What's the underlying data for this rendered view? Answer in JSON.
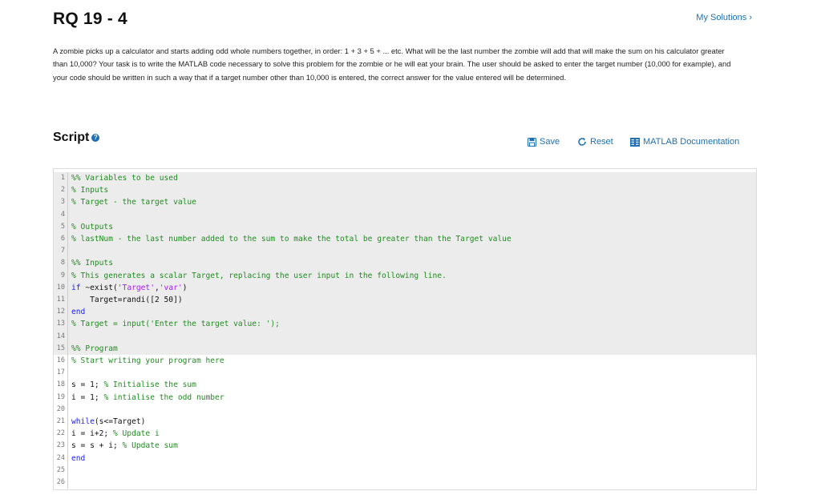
{
  "header": {
    "title": "RQ 19 - 4",
    "my_solutions": "My Solutions ›"
  },
  "problem": {
    "description": "A zombie picks up a calculator and starts adding odd whole numbers together, in order: 1 + 3 + 5 + ... etc. What will be the last number the zombie will add that will make the sum on his calculator greater than 10,000? Your task is to write the MATLAB code necessary to solve this problem for the zombie or he will eat your brain. The user should be asked to enter the target number (10,000 for example), and your code should be written in such a way that if a target number other than 10,000 is entered, the correct answer for the value entered will be determined."
  },
  "script": {
    "label": "Script",
    "help_icon": "?",
    "toolbar": {
      "save": "Save",
      "reset": "Reset",
      "docs": "MATLAB Documentation"
    }
  },
  "code": {
    "lines": [
      {
        "n": "1",
        "segs": [
          {
            "t": "%% Variables to be used",
            "c": "comment"
          }
        ]
      },
      {
        "n": "2",
        "segs": [
          {
            "t": "% Inputs",
            "c": "comment"
          }
        ]
      },
      {
        "n": "3",
        "segs": [
          {
            "t": "% Target - the target value",
            "c": "comment"
          }
        ]
      },
      {
        "n": "4",
        "segs": []
      },
      {
        "n": "5",
        "segs": [
          {
            "t": "% Outputs",
            "c": "comment"
          }
        ]
      },
      {
        "n": "6",
        "segs": [
          {
            "t": "% lastNum - the last number added to the sum to make the total be greater than the Target value",
            "c": "comment"
          }
        ]
      },
      {
        "n": "7",
        "segs": []
      },
      {
        "n": "8",
        "segs": [
          {
            "t": "%% Inputs",
            "c": "comment"
          }
        ]
      },
      {
        "n": "9",
        "segs": [
          {
            "t": "% This generates a scalar Target, replacing the user input in the following line.",
            "c": "comment"
          }
        ]
      },
      {
        "n": "10",
        "segs": [
          {
            "t": "if",
            "c": "kw"
          },
          {
            "t": " ~exist(",
            "c": ""
          },
          {
            "t": "'Target'",
            "c": "str"
          },
          {
            "t": ",",
            "c": ""
          },
          {
            "t": "'var'",
            "c": "str"
          },
          {
            "t": ")",
            "c": ""
          }
        ]
      },
      {
        "n": "11",
        "segs": [
          {
            "t": "    Target=randi([2 50])",
            "c": ""
          }
        ]
      },
      {
        "n": "12",
        "segs": [
          {
            "t": "end",
            "c": "kw"
          }
        ]
      },
      {
        "n": "13",
        "segs": [
          {
            "t": "% Target = input('Enter the target value: ');",
            "c": "comment"
          }
        ]
      },
      {
        "n": "14",
        "segs": []
      },
      {
        "n": "15",
        "segs": [
          {
            "t": "%% Program",
            "c": "comment"
          }
        ]
      },
      {
        "n": "16",
        "segs": [
          {
            "t": "% Start writing your program here",
            "c": "comment"
          }
        ]
      },
      {
        "n": "17",
        "segs": []
      },
      {
        "n": "18",
        "segs": [
          {
            "t": "s = 1; ",
            "c": ""
          },
          {
            "t": "% Initialise the sum",
            "c": "comment"
          }
        ]
      },
      {
        "n": "19",
        "segs": [
          {
            "t": "i = 1; ",
            "c": ""
          },
          {
            "t": "% intialise the odd number",
            "c": "comment"
          }
        ]
      },
      {
        "n": "20",
        "segs": []
      },
      {
        "n": "21",
        "segs": [
          {
            "t": "while",
            "c": "kw"
          },
          {
            "t": "(s<=Target)",
            "c": ""
          }
        ]
      },
      {
        "n": "22",
        "segs": [
          {
            "t": "i = i+2; ",
            "c": ""
          },
          {
            "t": "% Update i",
            "c": "comment"
          }
        ]
      },
      {
        "n": "23",
        "segs": [
          {
            "t": "s = s + i; ",
            "c": ""
          },
          {
            "t": "% Update sum",
            "c": "comment"
          }
        ]
      },
      {
        "n": "24",
        "segs": [
          {
            "t": "end",
            "c": "kw"
          }
        ]
      },
      {
        "n": "25",
        "segs": []
      },
      {
        "n": "26",
        "segs": []
      }
    ],
    "locked_line_count": 15
  },
  "colors": {
    "link": "#1f6fb2",
    "comment": "#228b22",
    "keyword": "#1a1aff",
    "string": "#a020f0",
    "locked_bg": "#ececec"
  }
}
